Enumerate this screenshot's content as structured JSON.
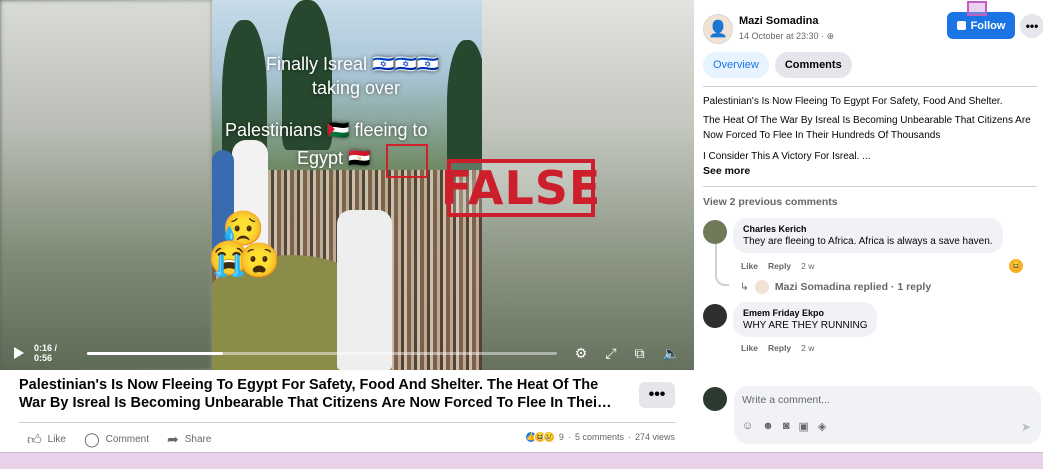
{
  "video": {
    "overlay_line1": "Finally Isreal 🇮🇱🇮🇱🇮🇱",
    "overlay_line2": "taking over",
    "overlay_line3": "Palestinians 🇵🇸 fleeing to",
    "overlay_line4": "Egypt 🇪🇬",
    "stamp_text": "FALSE",
    "time": "0:16 / 0:56",
    "progress_fraction": 0.29,
    "controls": [
      "settings-icon",
      "expand-icon",
      "pip-icon",
      "mute-icon"
    ]
  },
  "post": {
    "caption": "Palestinian's Is Now Fleeing To Egypt For Safety, Food And Shelter. The Heat Of The War By Isreal Is Becoming Unbearable That Citizens Are Now Forced To Flee In Thei…",
    "more_label": "•••",
    "actions": {
      "like": "Like",
      "comment": "Comment",
      "share": "Share"
    },
    "stats": {
      "reaction_count": "9",
      "comments": "5 comments",
      "views": "274 views"
    }
  },
  "sidebar": {
    "author": "Mazi Somadina",
    "time": "14 October at 23:30 · ",
    "follow_label": "Follow",
    "more_label": "•••",
    "tabs": [
      {
        "label": "Overview",
        "active": true
      },
      {
        "label": "Comments",
        "active": false
      }
    ],
    "body": [
      "Palestinian's Is Now Fleeing To Egypt For Safety, Food And Shelter.",
      "The Heat Of The War By Isreal Is Becoming Unbearable That Citizens Are Now Forced To Flee In Their Hundreds Of Thousands",
      "I Consider This A Victory For Isreal. ..."
    ],
    "see_more": "See more",
    "previous_comments": "View 2 previous comments",
    "comments": [
      {
        "name": "Charles Kerich",
        "text": "They are fleeing to Africa. Africa is always a save haven.",
        "like": "Like",
        "reply": "Reply",
        "age": "2 w"
      },
      {
        "name": "Emem Friday Ekpo",
        "text": "WHY ARE THEY RUNNING",
        "like": "Like",
        "reply": "Reply",
        "age": "2 w"
      }
    ],
    "reply_summary": "Mazi Somadina replied · 1 reply",
    "write_placeholder": "Write a comment..."
  },
  "colors": {
    "accent": "#1b74e4",
    "stamp": "#cc1f2b"
  }
}
